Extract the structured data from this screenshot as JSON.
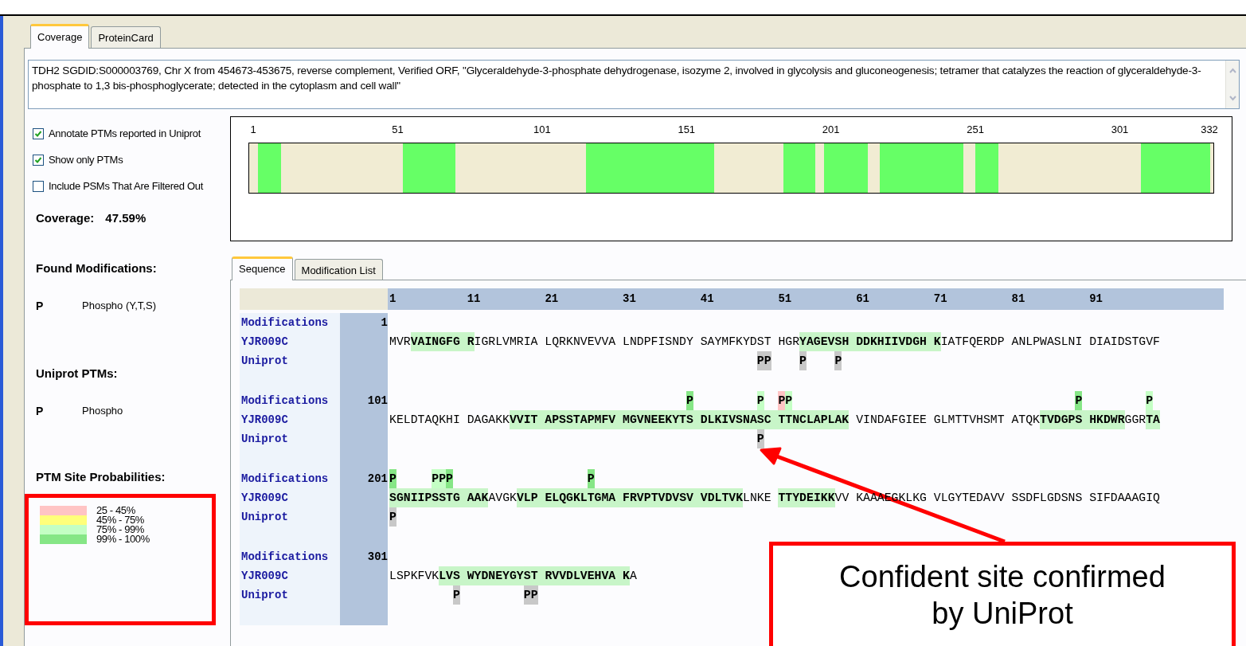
{
  "tabs": [
    {
      "label": "Coverage",
      "selected": true
    },
    {
      "label": "ProteinCard",
      "selected": false
    }
  ],
  "description": "TDH2 SGDID:S000003769, Chr X from 454673-453675, reverse complement, Verified ORF, \"Glyceraldehyde-3-phosphate dehydrogenase, isozyme 2, involved in glycolysis and gluconeogenesis; tetramer that catalyzes the reaction of glyceraldehyde-3-phosphate to 1,3 bis-phosphoglycerate; detected in the cytoplasm and cell wall\"",
  "options": [
    {
      "label": "Annotate PTMs reported in Uniprot",
      "checked": true
    },
    {
      "label": "Show only PTMs",
      "checked": true
    },
    {
      "label": "Include PSMs That Are Filtered Out",
      "checked": false
    }
  ],
  "coverage": {
    "label": "Coverage:",
    "value": "47.59%"
  },
  "coverage_map": {
    "ticks": [
      "1",
      "51",
      "101",
      "151",
      "201",
      "251",
      "301",
      "332"
    ]
  },
  "found_modifications": {
    "title": "Found Modifications:",
    "items": [
      {
        "symbol": "P",
        "name": "Phospho (Y,T,S)"
      }
    ]
  },
  "uniprot_ptms": {
    "title": "Uniprot PTMs:",
    "items": [
      {
        "symbol": "P",
        "name": "Phospho"
      }
    ]
  },
  "probabilities": {
    "title": "PTM Site Probabilities:",
    "legend": [
      {
        "label": "25 - 45%",
        "color": "#ffc4c4"
      },
      {
        "label": "45% - 75%",
        "color": "#ffff7a"
      },
      {
        "label": "75% - 99%",
        "color": "#c4ffc4"
      },
      {
        "label": "99% - 100%",
        "color": "#86e686"
      }
    ]
  },
  "sequence_tabs": [
    {
      "label": "Sequence",
      "selected": true
    },
    {
      "label": "Modification List",
      "selected": false
    }
  ],
  "sequence": {
    "header": [
      "1",
      "11",
      "21",
      "31",
      "41",
      "51",
      "61",
      "71",
      "81",
      "91"
    ],
    "rows": [
      {
        "start": "1",
        "track_labels": [
          "Modifications",
          "YJR009C",
          "Uniprot"
        ],
        "segments": [
          {
            "text": "MVR",
            "covered": false
          },
          {
            "text": "VAINGFG R",
            "covered": true
          },
          {
            "text": "IGRLVMRIA LQRKNVEVVA LNDPFISNDY SAYMFKYD",
            "covered": false
          },
          {
            "text": "S",
            "covered": false,
            "uniprot": "P"
          },
          {
            "text": "T",
            "covered": false,
            "uniprot": "P"
          },
          {
            "text": " HGR",
            "covered": false
          },
          {
            "text": "Y",
            "covered": true,
            "uniprot": "P"
          },
          {
            "text": "AGEV",
            "covered": true
          },
          {
            "text": "S",
            "covered": true,
            "uniprot": "P"
          },
          {
            "text": "H DDKHIIVDGH K",
            "covered": true
          },
          {
            "text": "IATFQERDP ANLPWASLNI DIAIDSTGVF",
            "covered": false
          }
        ]
      },
      {
        "start": "101",
        "track_labels": [
          "Modifications",
          "YJR009C",
          "Uniprot"
        ],
        "segments": [
          {
            "text": "KELDTAQKHI DAGAKK",
            "covered": false
          },
          {
            "text": "VVIT APSSTAPMFV MGVNEEKYT",
            "covered": true
          },
          {
            "text": "S",
            "covered": true,
            "mod": {
              "label": "P",
              "color": "#86e686"
            }
          },
          {
            "text": " DLKIVSNA",
            "covered": true
          },
          {
            "text": "S",
            "covered": true,
            "mod": {
              "label": "P",
              "color": "#c4ffc4"
            },
            "uniprot": "P"
          },
          {
            "text": "C ",
            "covered": true
          },
          {
            "text": "T",
            "covered": true,
            "mod": {
              "label": "P",
              "color": "#ffc4c4"
            }
          },
          {
            "text": "T",
            "covered": true,
            "mod": {
              "label": "P",
              "color": "#c4ffc4"
            }
          },
          {
            "text": "NCLAPLAK",
            "covered": true
          },
          {
            "text": " VINDAFGIEE GLMTTVHSMT ATQK",
            "covered": false
          },
          {
            "text": "TVDGP",
            "covered": true
          },
          {
            "text": "S",
            "covered": true,
            "mod": {
              "label": "P",
              "color": "#86e686"
            }
          },
          {
            "text": " HKDWR",
            "covered": true
          },
          {
            "text": "GGR",
            "covered": false
          },
          {
            "text": "T",
            "covered": true,
            "mod": {
              "label": "P",
              "color": "#c4ffc4"
            }
          },
          {
            "text": "A",
            "covered": true
          }
        ]
      },
      {
        "start": "201",
        "track_labels": [
          "Modifications",
          "YJR009C",
          "Uniprot"
        ],
        "segments": [
          {
            "text": "S",
            "covered": true,
            "mod": {
              "label": "P",
              "color": "#86e686"
            },
            "uniprot": "P"
          },
          {
            "text": "GNIIP",
            "covered": true
          },
          {
            "text": "S",
            "covered": true,
            "mod": {
              "label": "P",
              "color": "#c4ffc4"
            }
          },
          {
            "text": "S",
            "covered": true,
            "mod": {
              "label": "P",
              "color": "#c4ffc4"
            }
          },
          {
            "text": "T",
            "covered": true,
            "mod": {
              "label": "P",
              "color": "#86e686"
            }
          },
          {
            "text": "G AAK",
            "covered": true
          },
          {
            "text": "AVGK",
            "covered": false
          },
          {
            "text": "VLP ELQGKL",
            "covered": true
          },
          {
            "text": "T",
            "covered": true,
            "mod": {
              "label": "P",
              "color": "#86e686"
            }
          },
          {
            "text": "GMA FRVPTVDVSV VDLTVK",
            "covered": true
          },
          {
            "text": "LNKE ",
            "covered": false
          },
          {
            "text": "TTYDEIKK",
            "covered": true
          },
          {
            "text": "VV KAAAEGKLKG VLGYTEDAVV SSDFLGDSNS SIFDAAAGIQ",
            "covered": false
          }
        ]
      },
      {
        "start": "301",
        "track_labels": [
          "Modifications",
          "YJR009C",
          "Uniprot"
        ],
        "segments": [
          {
            "text": "LSPKFVK",
            "covered": false
          },
          {
            "text": "LV",
            "covered": true
          },
          {
            "text": "S",
            "covered": true,
            "uniprot": "P"
          },
          {
            "text": " WYDNEYGY",
            "covered": true
          },
          {
            "text": "S",
            "covered": true,
            "uniprot": "P"
          },
          {
            "text": "T",
            "covered": true,
            "uniprot": "P"
          },
          {
            "text": " RVVDLVEHVA K",
            "covered": true
          },
          {
            "text": "A",
            "covered": false
          }
        ]
      }
    ]
  },
  "callout": {
    "text": "Confident site confirmed by UniProt"
  }
}
